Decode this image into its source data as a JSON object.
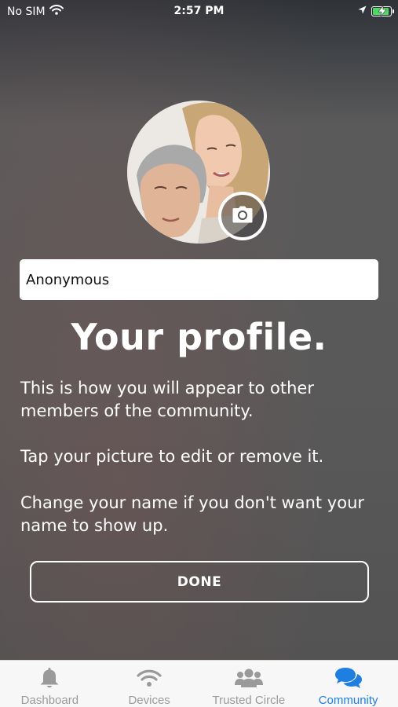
{
  "status_bar": {
    "carrier": "No SIM",
    "time": "2:57 PM"
  },
  "profile": {
    "name_value": "Anonymous",
    "title": "Your profile.",
    "paragraphs": [
      "This is how you will appear to other members of the community.",
      "Tap your picture to edit or remove it.",
      "Change your name if you don't want your name to show up."
    ],
    "done_label": "DONE"
  },
  "tabs": [
    {
      "label": "Dashboard",
      "icon": "bell-icon",
      "active": false
    },
    {
      "label": "Devices",
      "icon": "wifi-signal-icon",
      "active": false
    },
    {
      "label": "Trusted Circle",
      "icon": "group-icon",
      "active": false
    },
    {
      "label": "Community",
      "icon": "chat-bubbles-icon",
      "active": true
    }
  ],
  "colors": {
    "accent": "#1f7fe0",
    "inactive_tab": "#9a9a9a",
    "battery_green": "#4cd964"
  }
}
